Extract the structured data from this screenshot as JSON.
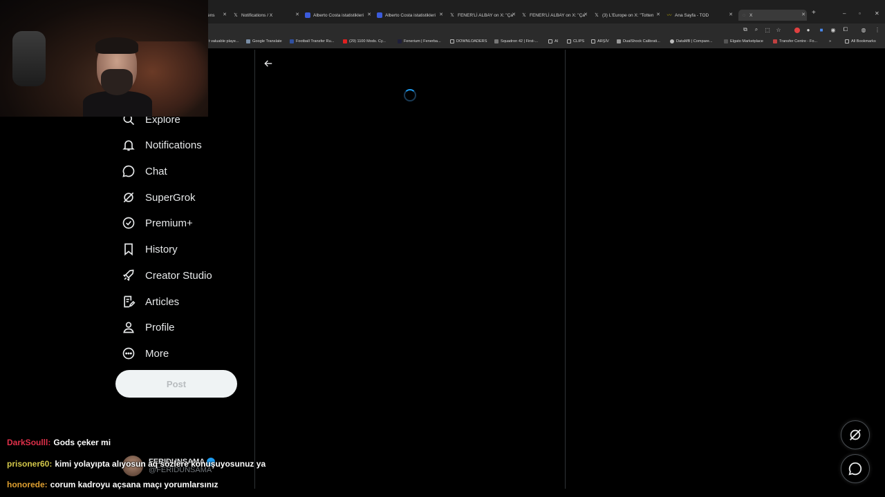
{
  "browser": {
    "tabs": [
      {
        "label": "ens",
        "favicon": "page-icon"
      },
      {
        "label": "Notifications / X",
        "favicon": "x-logo-icon"
      },
      {
        "label": "Alberto Costa istatistikleri",
        "favicon": "stats-site-icon"
      },
      {
        "label": "Alberto Costa istatistikleri",
        "favicon": "stats-site-icon"
      },
      {
        "label": "FENER'Lİ ALBAY on X: \"Ça",
        "favicon": "x-logo-icon"
      },
      {
        "label": "FENER'Lİ ALBAY on X: \"Ça",
        "favicon": "x-logo-icon"
      },
      {
        "label": "(3) L'Europe on X: \"Totten",
        "favicon": "x-logo-icon"
      },
      {
        "label": "Ana Sayfa - TOD",
        "favicon": "tod-icon"
      },
      {
        "label": "X",
        "favicon": "loading-icon"
      }
    ],
    "new_tab_symbol": "+",
    "bookmarks": [
      {
        "label": "t valuable playe..."
      },
      {
        "label": "Google Translate"
      },
      {
        "label": "Football Transfer Ru..."
      },
      {
        "label": "(29) 1100 Mods. Cy..."
      },
      {
        "label": "Fenerium | Fenerba..."
      },
      {
        "label": "DOWNLOADERS"
      },
      {
        "label": "Squadron 42 | First-..."
      },
      {
        "label": "AI"
      },
      {
        "label": "CLIPS"
      },
      {
        "label": "ARŞİV"
      },
      {
        "label": "DualShock Calibrati..."
      },
      {
        "label": "DataMB | Compare..."
      },
      {
        "label": "Elgato Marketplace"
      },
      {
        "label": "Transfer Centre - Fo..."
      },
      {
        "label": "All Bookmarks"
      }
    ]
  },
  "sidebar": {
    "items": [
      {
        "label": "Explore",
        "icon": "search-icon"
      },
      {
        "label": "Notifications",
        "icon": "bell-icon"
      },
      {
        "label": "Chat",
        "icon": "chat-bubble-icon"
      },
      {
        "label": "SuperGrok",
        "icon": "grok-icon"
      },
      {
        "label": "Premium+",
        "icon": "verified-badge-icon"
      },
      {
        "label": "History",
        "icon": "bookmark-icon"
      },
      {
        "label": "Creator Studio",
        "icon": "rocket-icon"
      },
      {
        "label": "Articles",
        "icon": "article-icon"
      },
      {
        "label": "Profile",
        "icon": "person-icon"
      },
      {
        "label": "More",
        "icon": "more-circle-icon"
      }
    ],
    "post_label": "Post"
  },
  "account": {
    "name": "FERIDUNSAMA",
    "handle": "@FERIDUNSAMA"
  },
  "chat_overlay": [
    {
      "user": "DarkSoulll:",
      "message": "Gods çeker mi",
      "color": "#e0304a"
    },
    {
      "user": "prisoner60:",
      "message": "kimi yolayıpta alıyosun aq sözlere konuşuyosunuz ya",
      "color": "#d4c84a"
    },
    {
      "user": "honorede:",
      "message": "corum kadroyu açsana maçı yorumlarsınız",
      "color": "#e0a030"
    }
  ],
  "colors": {
    "accent": "#1d9bf0",
    "background": "#000000",
    "border": "#2f3336",
    "text": "#e7e9ea"
  }
}
